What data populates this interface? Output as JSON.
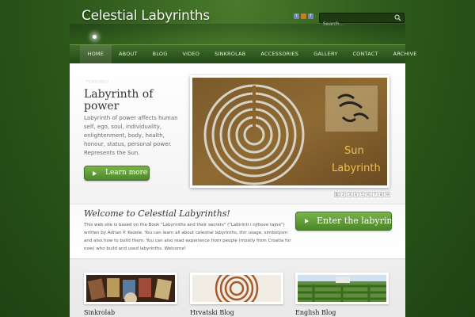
{
  "header": {
    "logo": "Celestial Labyrinths",
    "search_placeholder": "Search..."
  },
  "nav": {
    "items": [
      "HOME",
      "ABOUT",
      "BLOG",
      "VIDEO",
      "SINKROLAB",
      "ACCESSORIES",
      "GALLERY",
      "CONTACT",
      "ARCHIVE"
    ],
    "active": "HOME"
  },
  "featured": {
    "tab_label": "FEATURED",
    "title": "Labyrinth of power",
    "description": "Labyrinth of power affects human self, ego, soul, individuality, enlightenment, body, health, honour, status, personal power. Represents the Sun.",
    "button_label": "Learn more",
    "slide_caption_line1": "Sun",
    "slide_caption_line2": "Labyrinth",
    "pages": [
      "1",
      "2",
      "3",
      "4",
      "5",
      "6",
      "7",
      "8",
      "9"
    ],
    "active_page": "1"
  },
  "welcome": {
    "title": "Welcome to Celestial Labyrinths!",
    "text": "This web site is based on the Book \"Labyrinths and their secrets\" (\"Labirinti i njihove tajne\") written by Adrian P. Kezele. You can learn all about celestial labyrinths, thir usage, simbolysm and also how to build them. You can also read experience from people (mostly from Croatia for now) who build and used labyrinths. Welcome!",
    "button_label": "Enter the labyrinth"
  },
  "thumbnails": [
    {
      "label": "Sinkrolab"
    },
    {
      "label": "Hrvatski Blog"
    },
    {
      "label": "English Blog"
    }
  ],
  "colors": {
    "accent_green": "#5a9a32",
    "background_green": "#2e5a1c"
  }
}
